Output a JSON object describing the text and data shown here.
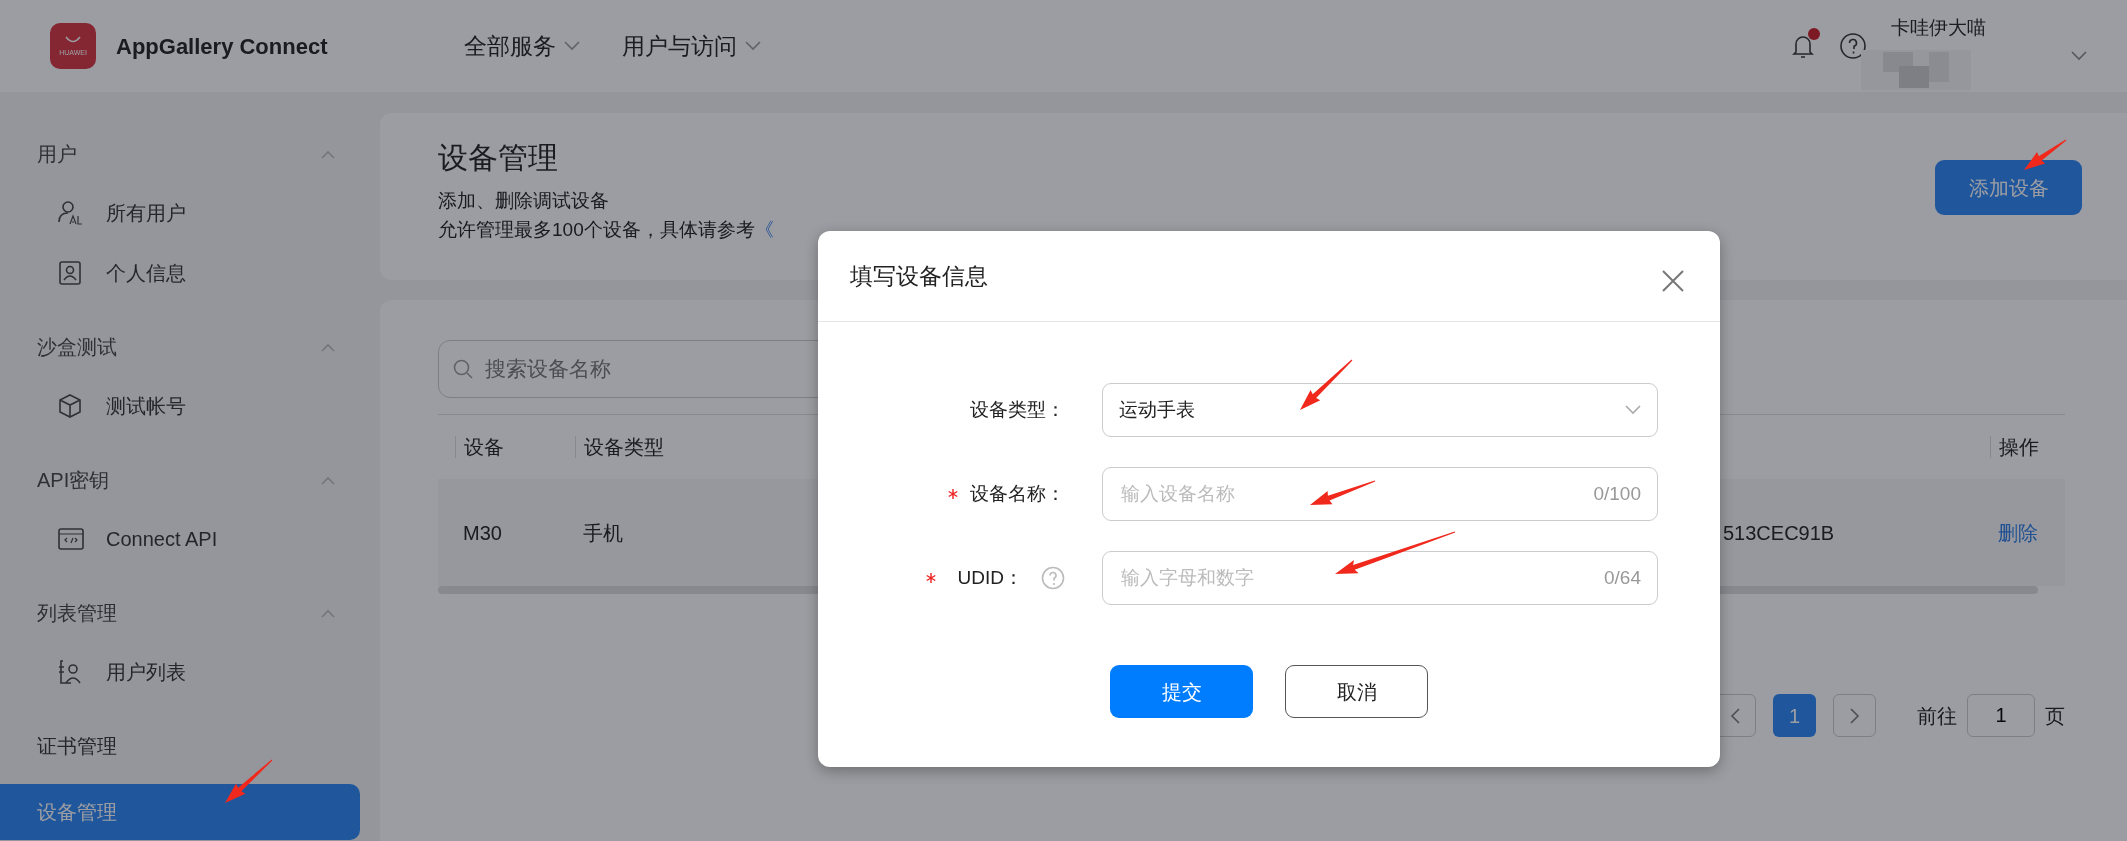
{
  "app": {
    "logo_text": "HUAWEI",
    "title": "AppGallery Connect"
  },
  "top_nav": [
    {
      "label": "全部服务"
    },
    {
      "label": "用户与访问"
    }
  ],
  "notifications": {
    "unread": true
  },
  "user": {
    "name": "卡哇伊大喵"
  },
  "sidebar": {
    "sections": [
      {
        "kind": "group",
        "title": "用户",
        "expanded": true,
        "items": [
          {
            "label": "所有用户",
            "selected": false
          },
          {
            "label": "个人信息",
            "selected": false
          }
        ]
      },
      {
        "kind": "group",
        "title": "沙盒测试",
        "expanded": true,
        "items": [
          {
            "label": "测试帐号",
            "selected": false
          }
        ]
      },
      {
        "kind": "group",
        "title": "API密钥",
        "expanded": true,
        "items": [
          {
            "label": "Connect API",
            "selected": false
          }
        ]
      },
      {
        "kind": "group",
        "title": "列表管理",
        "expanded": true,
        "items": [
          {
            "label": "用户列表",
            "selected": false
          }
        ]
      },
      {
        "kind": "link",
        "title": "证书管理",
        "selected": false
      },
      {
        "kind": "link",
        "title": "设备管理",
        "selected": true
      }
    ]
  },
  "page": {
    "title": "设备管理",
    "description": "添加、删除调试设备",
    "note": "允许管理最多100个设备，具体请参考",
    "guide_link": "《",
    "add_button": "添加设备"
  },
  "search": {
    "placeholder": "搜索设备名称"
  },
  "table": {
    "columns": [
      {
        "label": "设备"
      },
      {
        "label": "设备类型"
      },
      {
        "label": "操作"
      }
    ],
    "rows": [
      {
        "device": "M30",
        "type": "手机",
        "udid": "513CEC91B",
        "action": "删除"
      }
    ]
  },
  "pagination": {
    "pages": [
      {
        "label": "1",
        "selected": true
      }
    ],
    "goto_label": "前往",
    "goto_value": "1",
    "page_suffix": "页"
  },
  "dialog": {
    "title": "填写设备信息",
    "fields": [
      {
        "kind": "select",
        "label": "设备类型：",
        "required": false,
        "help": false,
        "value": "运动手表"
      },
      {
        "kind": "text",
        "label": "设备名称：",
        "required": true,
        "help": false,
        "placeholder": "输入设备名称",
        "counter": "0/100"
      },
      {
        "kind": "text",
        "label": "UDID：",
        "required": true,
        "help": true,
        "placeholder": "输入字母和数字",
        "counter": "0/64"
      }
    ],
    "buttons": [
      {
        "label": "提交",
        "primary": true
      },
      {
        "label": "取消",
        "primary": false
      }
    ]
  }
}
